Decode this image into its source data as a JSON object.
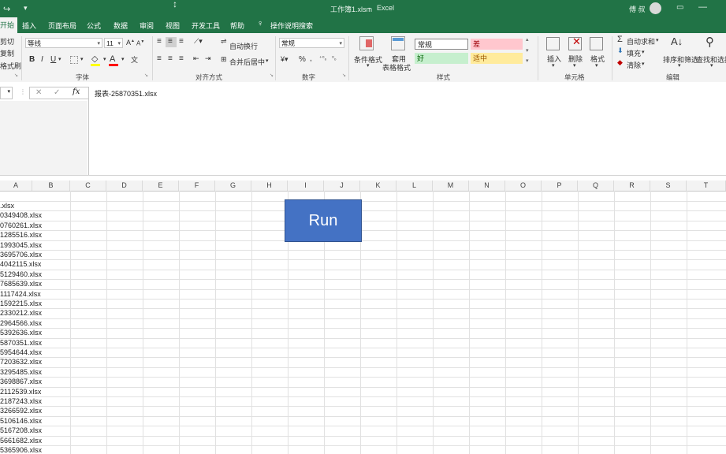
{
  "app": {
    "title": "工作簿1.xlsm",
    "app_name": "Excel",
    "user": "傅 叔"
  },
  "tabs": [
    {
      "label": "开始"
    },
    {
      "label": "插入"
    },
    {
      "label": "页面布局"
    },
    {
      "label": "公式"
    },
    {
      "label": "数据"
    },
    {
      "label": "审阅"
    },
    {
      "label": "视图"
    },
    {
      "label": "开发工具"
    },
    {
      "label": "帮助"
    },
    {
      "label": "操作说明搜索"
    }
  ],
  "ribbon": {
    "clipboard": {
      "cut": "剪切",
      "copy": "复制",
      "format_painter": "格式刷"
    },
    "font": {
      "family": "等线",
      "size": "11",
      "group": "字体",
      "bold": "B",
      "italic": "I",
      "underline": "U"
    },
    "alignment": {
      "wrap": "自动换行",
      "merge": "合并后居中",
      "group": "对齐方式"
    },
    "number": {
      "format": "常规",
      "percent": "%",
      "comma": ",",
      "group": "数字"
    },
    "styles": {
      "cond_format": "条件格式",
      "table_format_1": "套用",
      "table_format_2": "表格格式",
      "normal": "常规",
      "bad": "差",
      "good": "好",
      "neutral": "适中",
      "group": "样式"
    },
    "cells": {
      "insert": "插入",
      "delete": "删除",
      "format": "格式",
      "group": "单元格"
    },
    "editing": {
      "autosum": "自动求和",
      "fill": "填充",
      "clear": "清除",
      "sort": "排序和筛选",
      "find": "查找和选择",
      "group": "编辑"
    }
  },
  "formula_bar": {
    "fx": "fx",
    "value": "报表-25870351.xlsx"
  },
  "columns": [
    "A",
    "B",
    "C",
    "D",
    "E",
    "F",
    "G",
    "H",
    "I",
    "J",
    "K",
    "L",
    "M",
    "N",
    "O",
    "P",
    "Q",
    "R",
    "S",
    "T"
  ],
  "cells_a": [
    ".xlsx",
    "0349408.xlsx",
    "0760261.xlsx",
    "1285516.xlsx",
    "1993045.xlsx",
    "3695706.xlsx",
    "4042115.xlsx",
    "5129460.xlsx",
    "7685639.xlsx",
    "1117424.xlsx",
    "1592215.xlsx",
    "2330212.xlsx",
    "2964566.xlsx",
    "5392636.xlsx",
    "5870351.xlsx",
    "5954644.xlsx",
    "7203632.xlsx",
    "3295485.xlsx",
    "3698867.xlsx",
    "2112539.xlsx",
    "2187243.xlsx",
    "3266592.xlsx",
    "5106146.xlsx",
    "5167208.xlsx",
    "5661682.xlsx",
    "5365906.xlsx"
  ],
  "run_button": {
    "label": "Run"
  },
  "colors": {
    "excel_green": "#217346",
    "run_blue": "#4472c4",
    "bad_fill": "#ffc7ce",
    "good_fill": "#c6efce",
    "neutral_fill": "#ffeb9c"
  }
}
